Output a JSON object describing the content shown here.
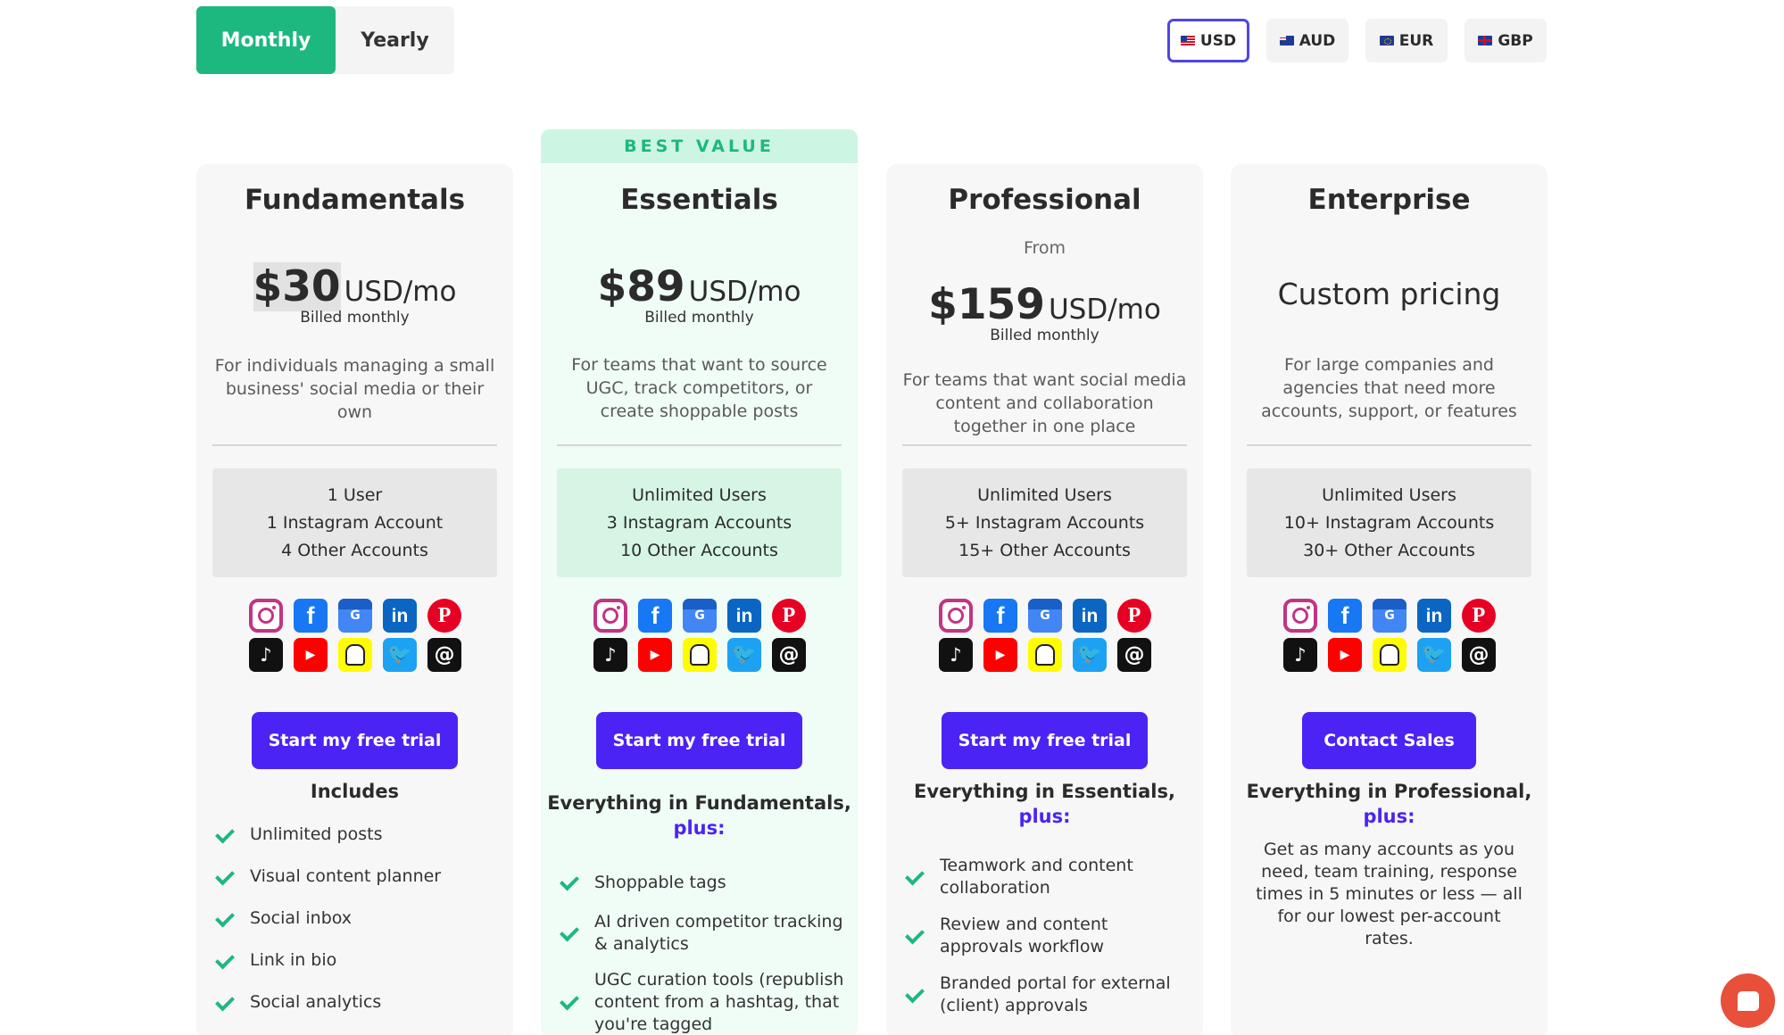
{
  "billing": {
    "monthly": "Monthly",
    "yearly": "Yearly",
    "selected": "Monthly"
  },
  "currencies": [
    "USD",
    "AUD",
    "EUR",
    "GBP"
  ],
  "selected_currency": "USD",
  "best_value_label": "BEST VALUE",
  "plans": [
    {
      "name": "Fundamentals",
      "price": "$30",
      "unit": "USD/mo",
      "billed": "Billed monthly",
      "description": "For individuals managing a small business' social media or their own",
      "accounts": [
        "1 User",
        "1 Instagram Account",
        "4 Other Accounts"
      ],
      "cta": "Start my free trial",
      "includes_title": "Includes",
      "features": [
        "Unlimited posts",
        "Visual content planner",
        "Social inbox",
        "Link in bio",
        "Social analytics"
      ]
    },
    {
      "name": "Essentials",
      "price": "$89",
      "unit": "USD/mo",
      "billed": "Billed monthly",
      "description": "For teams that want to source UGC, track competitors, or create shoppable posts",
      "accounts": [
        "Unlimited Users",
        "3 Instagram Accounts",
        "10 Other Accounts"
      ],
      "cta": "Start my free trial",
      "includes_title": "Everything in Fundamentals,",
      "includes_plus": "plus:",
      "features": [
        "Shoppable tags",
        "AI driven competitor tracking & analytics",
        "UGC curation tools (republish content from a hashtag, that you're tagged"
      ]
    },
    {
      "name": "Professional",
      "from": "From",
      "price": "$159",
      "unit": "USD/mo",
      "billed": "Billed monthly",
      "description": "For teams that want social media content and collaboration together in one place",
      "accounts": [
        "Unlimited Users",
        "5+ Instagram Accounts",
        "15+ Other Accounts"
      ],
      "cta": "Start my free trial",
      "includes_title": "Everything in Essentials,",
      "includes_plus": "plus:",
      "features": [
        "Teamwork and content collaboration",
        "Review and content approvals workflow",
        "Branded portal for external (client) approvals"
      ]
    },
    {
      "name": "Enterprise",
      "custom_price": "Custom pricing",
      "description": "For large companies and agencies that need more accounts, support, or features",
      "accounts": [
        "Unlimited Users",
        "10+ Instagram Accounts",
        "30+ Other Accounts"
      ],
      "cta": "Contact Sales",
      "includes_title": "Everything in Professional,",
      "includes_plus": "plus:",
      "details": "Get as many accounts as you need, team training, response times in 5 minutes or less — all for our lowest per-account rates."
    }
  ],
  "social_icons": [
    {
      "name": "instagram-icon",
      "glyph": ""
    },
    {
      "name": "facebook-icon",
      "glyph": "f"
    },
    {
      "name": "google-business-icon",
      "glyph": "G"
    },
    {
      "name": "linkedin-icon",
      "glyph": "in"
    },
    {
      "name": "pinterest-icon",
      "glyph": "P"
    },
    {
      "name": "tiktok-icon",
      "glyph": "♪"
    },
    {
      "name": "youtube-icon",
      "glyph": "▶"
    },
    {
      "name": "snapchat-icon",
      "glyph": ""
    },
    {
      "name": "twitter-icon",
      "glyph": "🐦"
    },
    {
      "name": "threads-icon",
      "glyph": "@"
    }
  ],
  "colors": {
    "accent_green": "#1db880",
    "cta_purple": "#4b23f5",
    "chat_orange": "#e8503a"
  }
}
